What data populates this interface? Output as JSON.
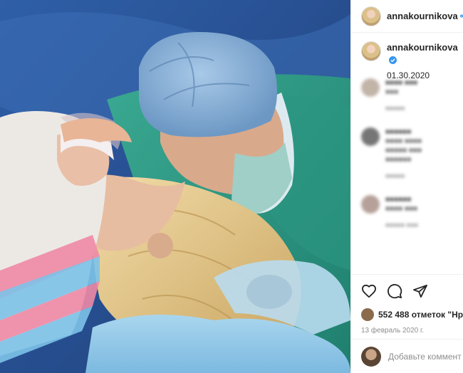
{
  "colors": {
    "verified": "#3897f0",
    "text": "#262626",
    "muted": "#8e8e8e",
    "border": "#efefef"
  },
  "header": {
    "username": "annakournikova",
    "icons": [
      "avatar",
      "verified-badge-icon"
    ]
  },
  "caption": {
    "username": "annakournikova",
    "text": "01.30.2020"
  },
  "actions": {
    "icons": [
      "heart-icon",
      "comment-icon",
      "share-icon"
    ],
    "likes_text": "552 488 отметок \"Нра",
    "date": "13 февраль 2020 г."
  },
  "add_comment": {
    "placeholder": "Добавьте коммент"
  }
}
